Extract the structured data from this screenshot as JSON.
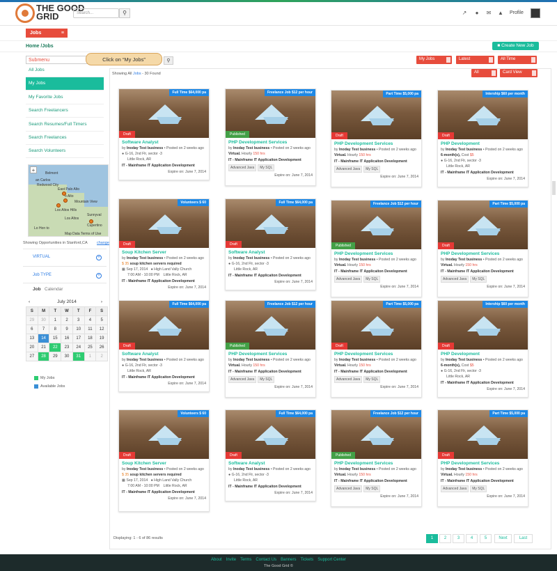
{
  "header": {
    "logo_line1": "THE GOOD",
    "logo_line2": "GRID",
    "search_placeholder": "Search...",
    "profile_label": "Profile",
    "icons": [
      "external-link-icon",
      "users-icon",
      "envelope-icon",
      "bell-icon"
    ]
  },
  "jobs_menu_label": "Jobs",
  "breadcrumb": "Home /Jobs",
  "create_button": "Create New Job",
  "submenu": {
    "label": "Submenu",
    "tooltip": "Click on “My Jobs”",
    "items": [
      "All Jobs",
      "My Jobs",
      "My Favorite Jobs",
      "Search Freelancers",
      "Search Resumes/Full Timers",
      "Search Freelances",
      "Search Volunteers"
    ],
    "active_index": 1
  },
  "map": {
    "cities": [
      "Belmont",
      "an Carlos",
      "Redwood City",
      "East Palo Alto",
      "o Alto",
      "Mountain View",
      "Los Altos Hills",
      "Sunnyval",
      "Los Altos",
      "Cupertino",
      "Lo Hon to"
    ],
    "footer": "Map Data   Terms of Use"
  },
  "location": {
    "text": "Showing Opportunities in Stanford,CA",
    "change": "change"
  },
  "filters": [
    {
      "label": "VIRTUAL"
    },
    {
      "label": "Job TYPE"
    }
  ],
  "tabs": {
    "job": "Job",
    "calendar": "Calendar"
  },
  "calendar": {
    "month": "July 2014",
    "prev": "‹",
    "next": "›",
    "days": [
      "S",
      "M",
      "T",
      "W",
      "T",
      "F",
      "S"
    ],
    "cells": [
      {
        "d": "29",
        "c": "muted"
      },
      {
        "d": "30",
        "c": "muted"
      },
      {
        "d": "1",
        "c": ""
      },
      {
        "d": "2",
        "c": ""
      },
      {
        "d": "3",
        "c": ""
      },
      {
        "d": "4",
        "c": ""
      },
      {
        "d": "5",
        "c": ""
      },
      {
        "d": "6",
        "c": ""
      },
      {
        "d": "7",
        "c": ""
      },
      {
        "d": "8",
        "c": ""
      },
      {
        "d": "9",
        "c": ""
      },
      {
        "d": "10",
        "c": ""
      },
      {
        "d": "11",
        "c": ""
      },
      {
        "d": "12",
        "c": ""
      },
      {
        "d": "13",
        "c": ""
      },
      {
        "d": "14",
        "c": "b"
      },
      {
        "d": "15",
        "c": ""
      },
      {
        "d": "16",
        "c": ""
      },
      {
        "d": "17",
        "c": ""
      },
      {
        "d": "18",
        "c": ""
      },
      {
        "d": "19",
        "c": ""
      },
      {
        "d": "20",
        "c": ""
      },
      {
        "d": "21",
        "c": ""
      },
      {
        "d": "22",
        "c": "g"
      },
      {
        "d": "23",
        "c": ""
      },
      {
        "d": "24",
        "c": ""
      },
      {
        "d": "25",
        "c": ""
      },
      {
        "d": "26",
        "c": ""
      },
      {
        "d": "27",
        "c": ""
      },
      {
        "d": "28",
        "c": "g"
      },
      {
        "d": "29",
        "c": ""
      },
      {
        "d": "30",
        "c": ""
      },
      {
        "d": "31",
        "c": "g"
      },
      {
        "d": "1",
        "c": "muted"
      },
      {
        "d": "2",
        "c": "muted"
      }
    ],
    "legend": [
      {
        "label": "My Jobs",
        "color": "#2ecc71"
      },
      {
        "label": "Available Jobs",
        "color": "#3a8fd6"
      }
    ]
  },
  "results": {
    "showing_prefix": "Showing All ",
    "showing_link": "Jobs",
    "showing_suffix": " - 30 Found"
  },
  "dropdowns": {
    "my_jobs": "My Jobs",
    "latest": "Latest",
    "all_time": "All Time",
    "all": "All",
    "view": "Card View"
  },
  "cards": [
    {
      "type": "ft",
      "status": "Draft"
    },
    {
      "type": "fl",
      "status": "Published"
    },
    {
      "type": "pt",
      "status": "Draft"
    },
    {
      "type": "in",
      "status": "Draft"
    },
    {
      "type": "vol",
      "status": "Draft"
    },
    {
      "type": "ft",
      "status": "Draft"
    },
    {
      "type": "fl",
      "status": "Published"
    },
    {
      "type": "pt",
      "status": "Draft"
    },
    {
      "type": "ft",
      "status": "Draft"
    },
    {
      "type": "fl",
      "status": "Published"
    },
    {
      "type": "pt",
      "status": "Draft"
    },
    {
      "type": "in",
      "status": "Draft"
    },
    {
      "type": "vol",
      "status": "Draft"
    },
    {
      "type": "ft",
      "status": "Draft"
    },
    {
      "type": "fl",
      "status": "Published"
    },
    {
      "type": "pt",
      "status": "Draft"
    }
  ],
  "card_templates": {
    "ft": {
      "tag": "Full Time $64,000 pa",
      "title": "Software Analyst",
      "line2_loc": "G-16, 2nd Flr, sector -3",
      "line2_city": "Little Rock, AR",
      "chips": []
    },
    "fl": {
      "tag": "Freelance Job  $12 per hour",
      "title": "PHP Development Services",
      "virtual": "Virtual.",
      "hourly": "Hourly ",
      "hours": "150 hrs",
      "chips": [
        "Advanced Java",
        "My SQL"
      ]
    },
    "pt": {
      "tag": "Part Time $5,000 pa",
      "title": "PHP Development Services",
      "virtual": "Virtual.",
      "hourly": "Hourly ",
      "hours": "150 hrs",
      "chips": [
        "Advanced Java",
        "My SQL"
      ]
    },
    "in": {
      "tag": "Intership $60 per month",
      "title": "PHP Development",
      "virtual": "6-month(s),",
      "hourly": "Cost ",
      "hours": "$5",
      "line2_loc": "G-16, 2nd Flr, sector -3",
      "line2_city": "Little Rock, AR"
    },
    "vol": {
      "tag": "Volunteers  $ 60",
      "title": "Soup Kitchen Server",
      "slots": "$ 35",
      "desc": " soup kitchen servers required",
      "date": "Sep 17, 2014",
      "time": "7:00 AM - 10:00 PM",
      "place": "High Land Vally Church",
      "city": "Little Rock, AR"
    }
  },
  "common": {
    "by": "by",
    "poster": "Inoday Test business",
    "posted": " • Posted on 2 weeks ago",
    "categories": "IT - Mainframe    IT Applicaiton Development",
    "expire": "Expire on: June 7, 2014"
  },
  "pagination": {
    "displaying": "Displaying: 1 - 6 of 86 results",
    "pages": [
      "1",
      "2",
      "3",
      "4",
      "5",
      "Next",
      "Last"
    ]
  },
  "footer": {
    "links": [
      "About",
      "Invite",
      "Terms",
      "Contact Us",
      "Banners",
      "Tickets",
      "Support Center"
    ],
    "copyright": "The Good Grid ©"
  }
}
